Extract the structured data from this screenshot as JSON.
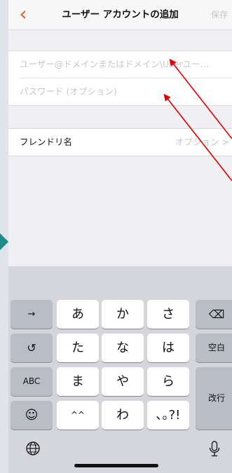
{
  "nav": {
    "back_icon": "chevron-left-icon",
    "title": "ユーザー アカウントの追加",
    "save_label": "保存"
  },
  "form": {
    "user_placeholder": "ユーザー@ドメインまたはドメイン\\Userユー…",
    "password_placeholder": "パスワード (オプション)",
    "friendly_name_label": "フレンドリ名",
    "friendly_name_value": "オプション",
    "chevron": ">"
  },
  "keyboard": {
    "row1": [
      "→",
      "あ",
      "か",
      "さ",
      "⌫"
    ],
    "row2": [
      "↺",
      "た",
      "な",
      "は",
      "空白"
    ],
    "row3": [
      "ABC",
      "ま",
      "や",
      "ら",
      "改行"
    ],
    "row4": [
      "☺",
      "^^",
      "わ",
      "､｡?!"
    ],
    "globe_icon": "globe-icon",
    "mic_icon": "microphone-icon"
  },
  "colors": {
    "accent": "#f05a28",
    "annotation_arrow": "#e00000"
  }
}
